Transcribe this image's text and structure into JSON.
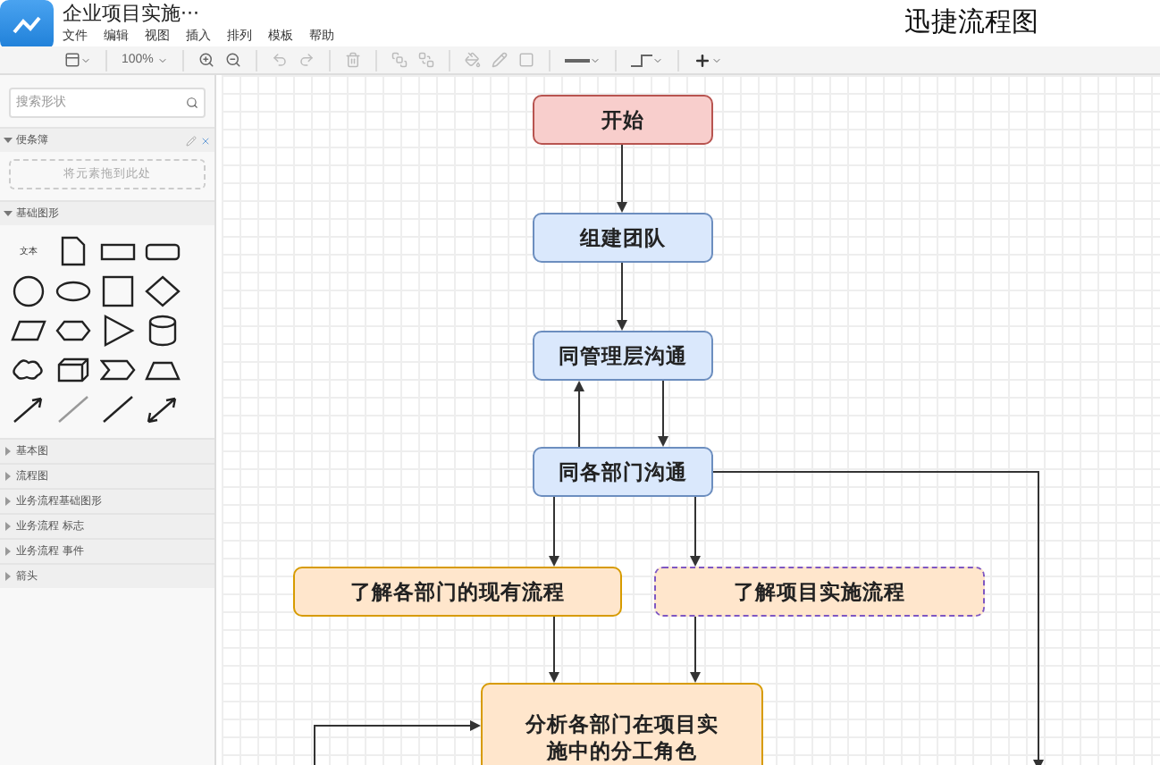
{
  "header": {
    "document_title": "企业项目实施···",
    "app_name": "迅捷流程图",
    "menu": [
      "文件",
      "编辑",
      "视图",
      "插入",
      "排列",
      "模板",
      "帮助"
    ]
  },
  "toolbar": {
    "zoom": "100%"
  },
  "sidebar": {
    "search": {
      "placeholder": "搜索形状"
    },
    "scratchpad": {
      "title": "便条簿",
      "expanded": true,
      "drop_hint": "将元素拖到此处"
    },
    "shape_section": {
      "title": "基础图形",
      "expanded": true,
      "text_shape_label": "文本"
    },
    "sections": [
      {
        "title": "基本图",
        "expanded": false
      },
      {
        "title": "流程图",
        "expanded": false
      },
      {
        "title": "业务流程基础图形",
        "expanded": false
      },
      {
        "title": "业务流程 标志",
        "expanded": false
      },
      {
        "title": "业务流程 事件",
        "expanded": false
      },
      {
        "title": "箭头",
        "expanded": false
      }
    ]
  },
  "diagram": {
    "nodes": [
      {
        "label": "开始",
        "kind": "start",
        "selected": false
      },
      {
        "label": "组建团队",
        "kind": "step",
        "selected": false
      },
      {
        "label": "同管理层沟通",
        "kind": "step",
        "selected": false
      },
      {
        "label": "同各部门沟通",
        "kind": "step",
        "selected": false
      },
      {
        "label": "了解各部门的现有流程",
        "kind": "task",
        "selected": false
      },
      {
        "label": "了解项目实施流程",
        "kind": "task",
        "selected": true
      },
      {
        "label": "分析各部门在项目实施中的分工角色",
        "kind": "task",
        "selected": false
      }
    ]
  }
}
